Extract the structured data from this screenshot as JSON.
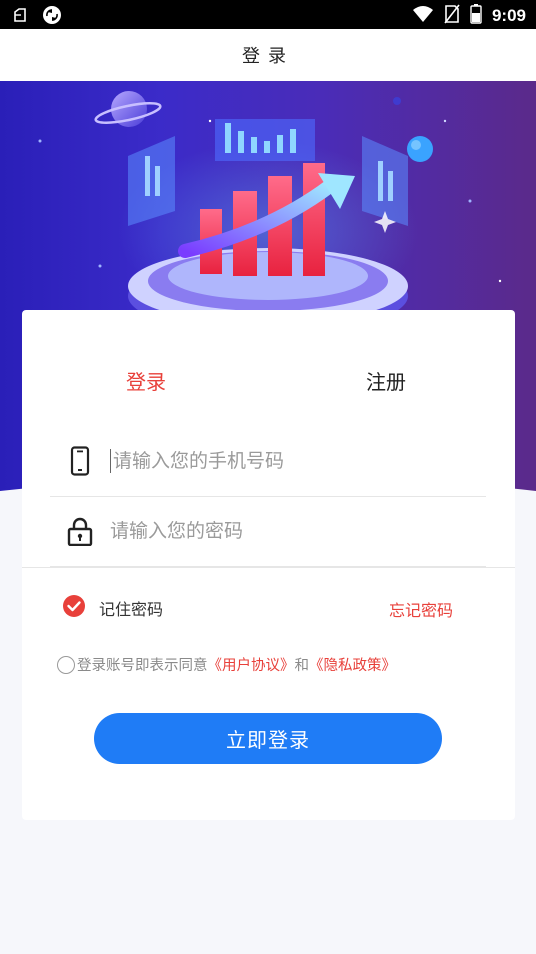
{
  "status_bar": {
    "time": "9:09",
    "icons": [
      "notification-icon",
      "sync-icon",
      "wifi-icon",
      "no-sim-icon",
      "battery-icon"
    ]
  },
  "header": {
    "title": "登录"
  },
  "tabs": [
    {
      "label": "登录",
      "active": true
    },
    {
      "label": "注册",
      "active": false
    }
  ],
  "form": {
    "phone": {
      "placeholder": "请输入您的手机号码",
      "value": "",
      "icon": "phone-icon"
    },
    "password": {
      "placeholder": "请输入您的密码",
      "value": "",
      "icon": "lock-icon"
    },
    "remember": {
      "label": "记住密码",
      "checked": true
    },
    "forgot_label": "忘记密码",
    "agreement": {
      "prefix": "登录账号即表示同意",
      "user_agreement": "《用户协议》",
      "conjunction": "和",
      "privacy_policy": "《隐私政策》",
      "checked": false
    },
    "submit_label": "立即登录"
  },
  "colors": {
    "accent_red": "#e8403a",
    "button_blue": "#1f7cf6",
    "hero_left": "#2a1fb8",
    "hero_right": "#5b2a8a"
  }
}
